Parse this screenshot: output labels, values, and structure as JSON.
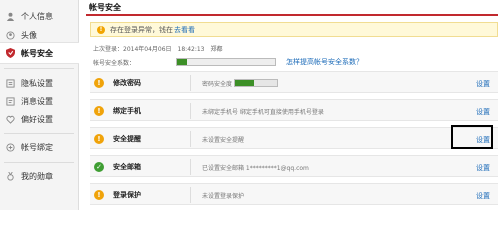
{
  "sidebar": {
    "items": [
      {
        "label": "个人信息",
        "icon": "person-icon"
      },
      {
        "label": "头像",
        "icon": "avatar-icon"
      },
      {
        "label": "帐号安全",
        "icon": "shield-icon",
        "active": true
      },
      {
        "label": "隐私设置",
        "icon": "privacy-icon"
      },
      {
        "label": "消息设置",
        "icon": "message-icon"
      },
      {
        "label": "偏好设置",
        "icon": "preference-icon"
      },
      {
        "label": "帐号绑定",
        "icon": "bind-icon"
      },
      {
        "label": "我的勋章",
        "icon": "medal-icon"
      }
    ]
  },
  "header": {
    "title": "帐号安全"
  },
  "alert": {
    "text": "存在登录异常，钱在",
    "link": "去看看"
  },
  "account": {
    "last_login": "上次登录：2014年04月06日　18:42:13　郑都",
    "security_label": "帐号安全系数：",
    "security_level": 0.1,
    "howto_link": "怎样提高帐号安全系数？"
  },
  "items": [
    {
      "name": "修改密码",
      "status": "warn",
      "desc": "密码安全度",
      "strength": 0.45,
      "action": "设置"
    },
    {
      "name": "绑定手机",
      "status": "warn",
      "desc": "未绑定手机号 绑定手机可直接使用手机号登录",
      "action": "设置"
    },
    {
      "name": "安全提醒",
      "status": "warn",
      "desc": "未设置安全提醒",
      "action": "设置"
    },
    {
      "name": "安全邮箱",
      "status": "ok",
      "desc": "已设置安全邮箱 1*********1@qq.com",
      "action": "设置"
    },
    {
      "name": "登录保护",
      "status": "warn",
      "desc": "未设置登录保护",
      "action": "设置"
    }
  ],
  "colors": {
    "accent": "#c1292e",
    "link": "#1a6ab8",
    "warning": "#f0a30a",
    "ok": "#3f9e33",
    "strength": "#3c8f26"
  }
}
